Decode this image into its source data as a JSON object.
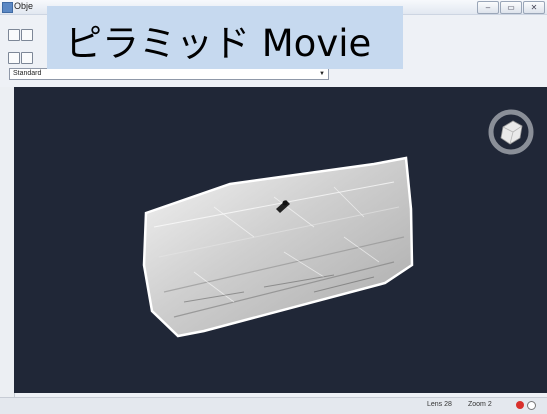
{
  "window": {
    "title": "Obje",
    "buttons": [
      "–",
      "▭",
      "✕"
    ]
  },
  "banner": {
    "text": "ピラミッド Movie"
  },
  "toolbar": {
    "visual_style": "Standard"
  },
  "status": {
    "lens": "Lens 28",
    "zoom": "Zoom 2"
  },
  "colors": {
    "viewport_bg": "#202737",
    "banner_bg": "#c6d9ef",
    "status_red": "#d9302c"
  },
  "icons": [
    "app-icon",
    "save-icon",
    "view-cube-icon",
    "orbit-ring-icon"
  ]
}
